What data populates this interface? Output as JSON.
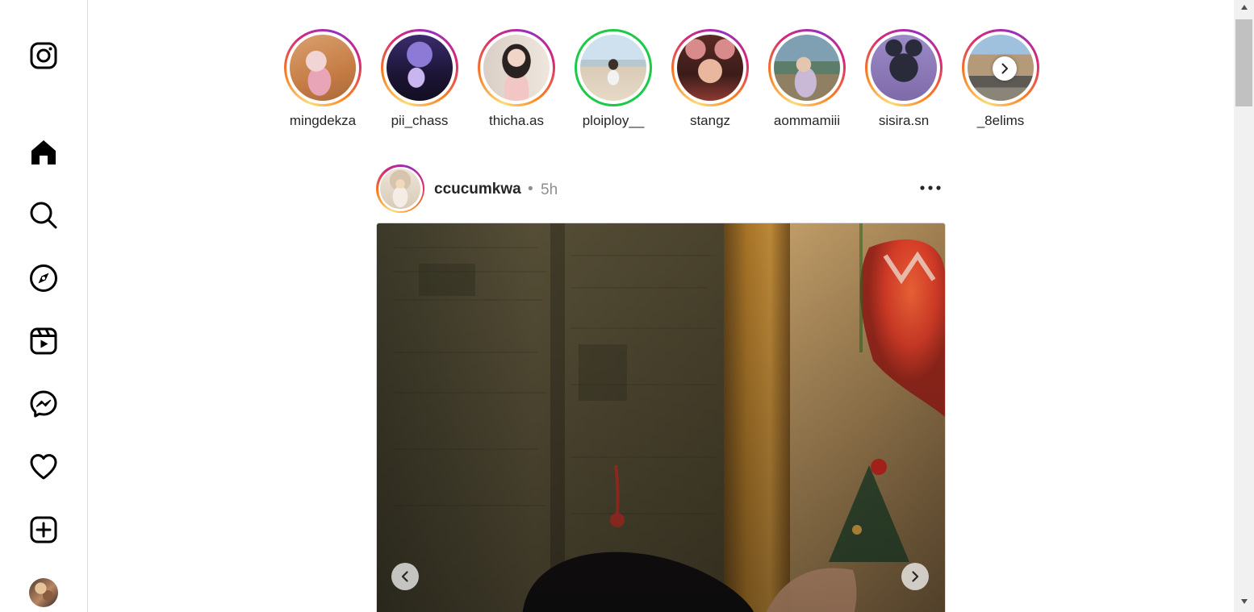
{
  "sidebar": {
    "items": [
      {
        "name": "instagram-logo",
        "icon": "instagram-glyph-icon"
      },
      {
        "name": "home",
        "icon": "home-icon",
        "active": true
      },
      {
        "name": "search",
        "icon": "search-icon"
      },
      {
        "name": "explore",
        "icon": "compass-icon"
      },
      {
        "name": "reels",
        "icon": "reels-icon"
      },
      {
        "name": "messages",
        "icon": "messenger-icon"
      },
      {
        "name": "notifications",
        "icon": "heart-icon"
      },
      {
        "name": "create",
        "icon": "plus-square-icon"
      },
      {
        "name": "profile",
        "icon": "avatar"
      }
    ]
  },
  "stories": {
    "items": [
      {
        "username": "mingdekza",
        "ring": "gradient"
      },
      {
        "username": "pii_chass",
        "ring": "gradient"
      },
      {
        "username": "thicha.as",
        "ring": "gradient"
      },
      {
        "username": "ploiploy__",
        "ring": "close-friends"
      },
      {
        "username": "stangz",
        "ring": "gradient"
      },
      {
        "username": "aommamiii",
        "ring": "gradient"
      },
      {
        "username": "sisira.sn",
        "ring": "gradient"
      },
      {
        "username": "_8elims",
        "ring": "gradient"
      }
    ],
    "next_icon": "chevron-right-icon"
  },
  "post": {
    "username": "ccucumkwa",
    "separator": "•",
    "time": "5h",
    "more_icon": "more-horizontal-icon",
    "carousel": {
      "prev_icon": "chevron-left-icon",
      "next_icon": "chevron-right-icon"
    }
  },
  "colors": {
    "story_ring_gradient": [
      "#feda75",
      "#fa7e1e",
      "#d62976",
      "#962fbf"
    ],
    "close_friends_ring": "#1ec94a",
    "border": "#dbdbdb",
    "text_primary": "#262626",
    "text_secondary": "#8e8e8e"
  }
}
